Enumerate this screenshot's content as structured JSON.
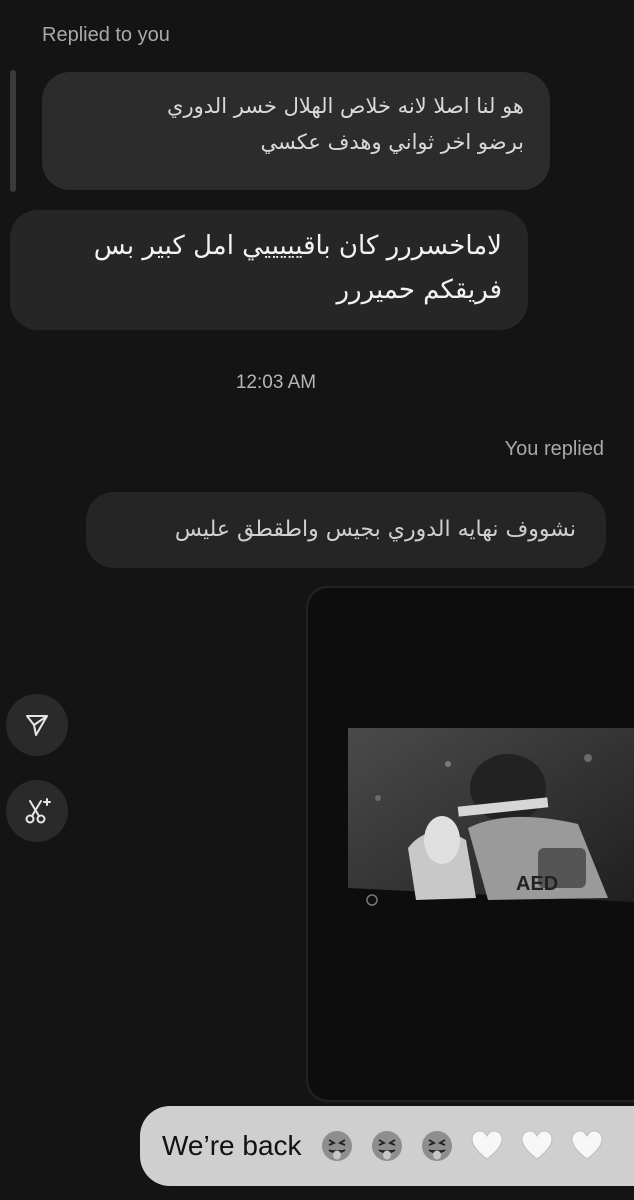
{
  "thread": {
    "replied_to_you_label": "Replied to you",
    "quoted_message": {
      "line1": "هو لنا اصلا لانه خلاص الهلال خسر الدوري",
      "line2": "برضو اخر ثواني وهدف عكسي"
    },
    "received_message": {
      "line1": "لاماخسررر كان باقيييييي امل كبير بس",
      "line2": "فريقكم حميررر"
    },
    "timestamp": "12:03 AM",
    "you_replied_label": "You replied",
    "my_quoted_message": "نشووف نهايه الدوري بجيس واطقطق عليس",
    "sent_message": {
      "text": "We’re back",
      "emojis": [
        "squinting-tongue",
        "squinting-tongue",
        "squinting-tongue",
        "white-heart",
        "white-heart",
        "white-heart"
      ]
    }
  },
  "side_actions": [
    "send-icon",
    "scissors-sparkle-icon"
  ],
  "colors": {
    "background": "#141414",
    "bubble_received": "#262626",
    "bubble_sent": "#cfcfcf"
  }
}
